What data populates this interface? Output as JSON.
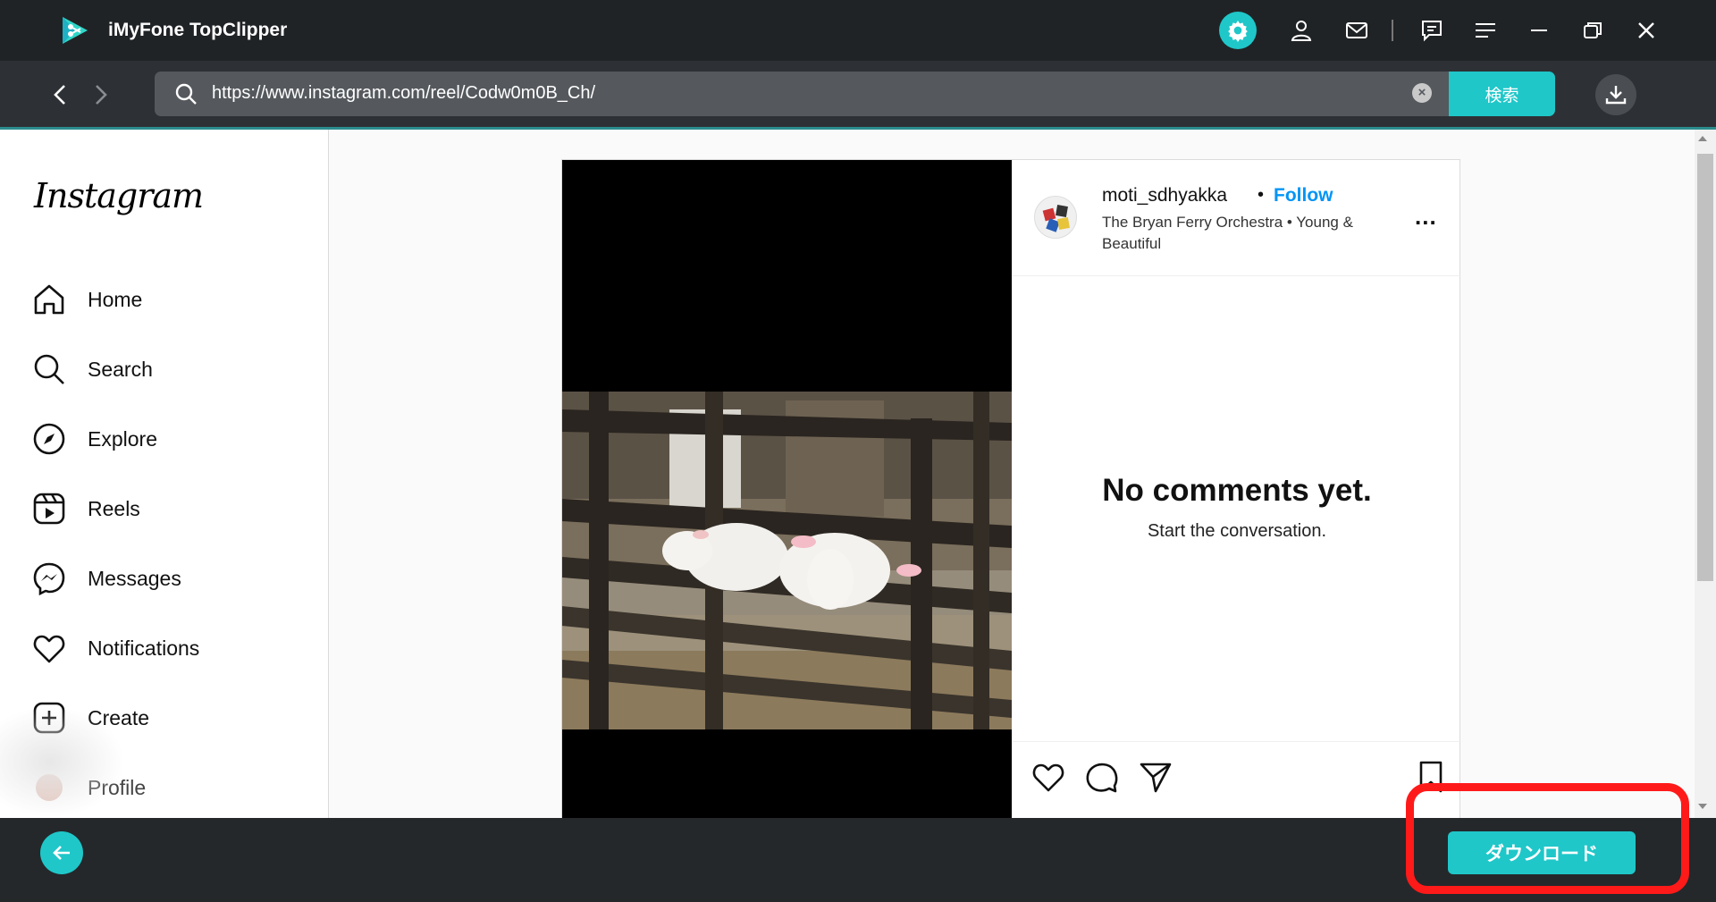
{
  "app": {
    "title": "iMyFone TopClipper"
  },
  "address_bar": {
    "url": "https://www.instagram.com/reel/Codw0m0B_Ch/",
    "search_button_label": "検索"
  },
  "sidebar": {
    "logo": "Instagram",
    "items": [
      {
        "label": "Home",
        "icon": "home-icon"
      },
      {
        "label": "Search",
        "icon": "search-icon"
      },
      {
        "label": "Explore",
        "icon": "compass-icon"
      },
      {
        "label": "Reels",
        "icon": "reels-icon"
      },
      {
        "label": "Messages",
        "icon": "messenger-icon"
      },
      {
        "label": "Notifications",
        "icon": "heart-icon"
      },
      {
        "label": "Create",
        "icon": "plus-square-icon"
      },
      {
        "label": "Profile",
        "icon": "avatar-icon"
      }
    ]
  },
  "post": {
    "username": "moti_sdhyakka",
    "separator": "•",
    "follow_label": "Follow",
    "audio": "The Bryan Ferry Orchestra • Young & Beautiful",
    "more": "...",
    "no_comments_title": "No comments yet.",
    "no_comments_subtitle": "Start the conversation."
  },
  "bottom_bar": {
    "download_label": "ダウンロード"
  },
  "colors": {
    "accent": "#1fc7c9",
    "highlight": "#ff1a1a",
    "instagram_blue": "#0095f6"
  }
}
